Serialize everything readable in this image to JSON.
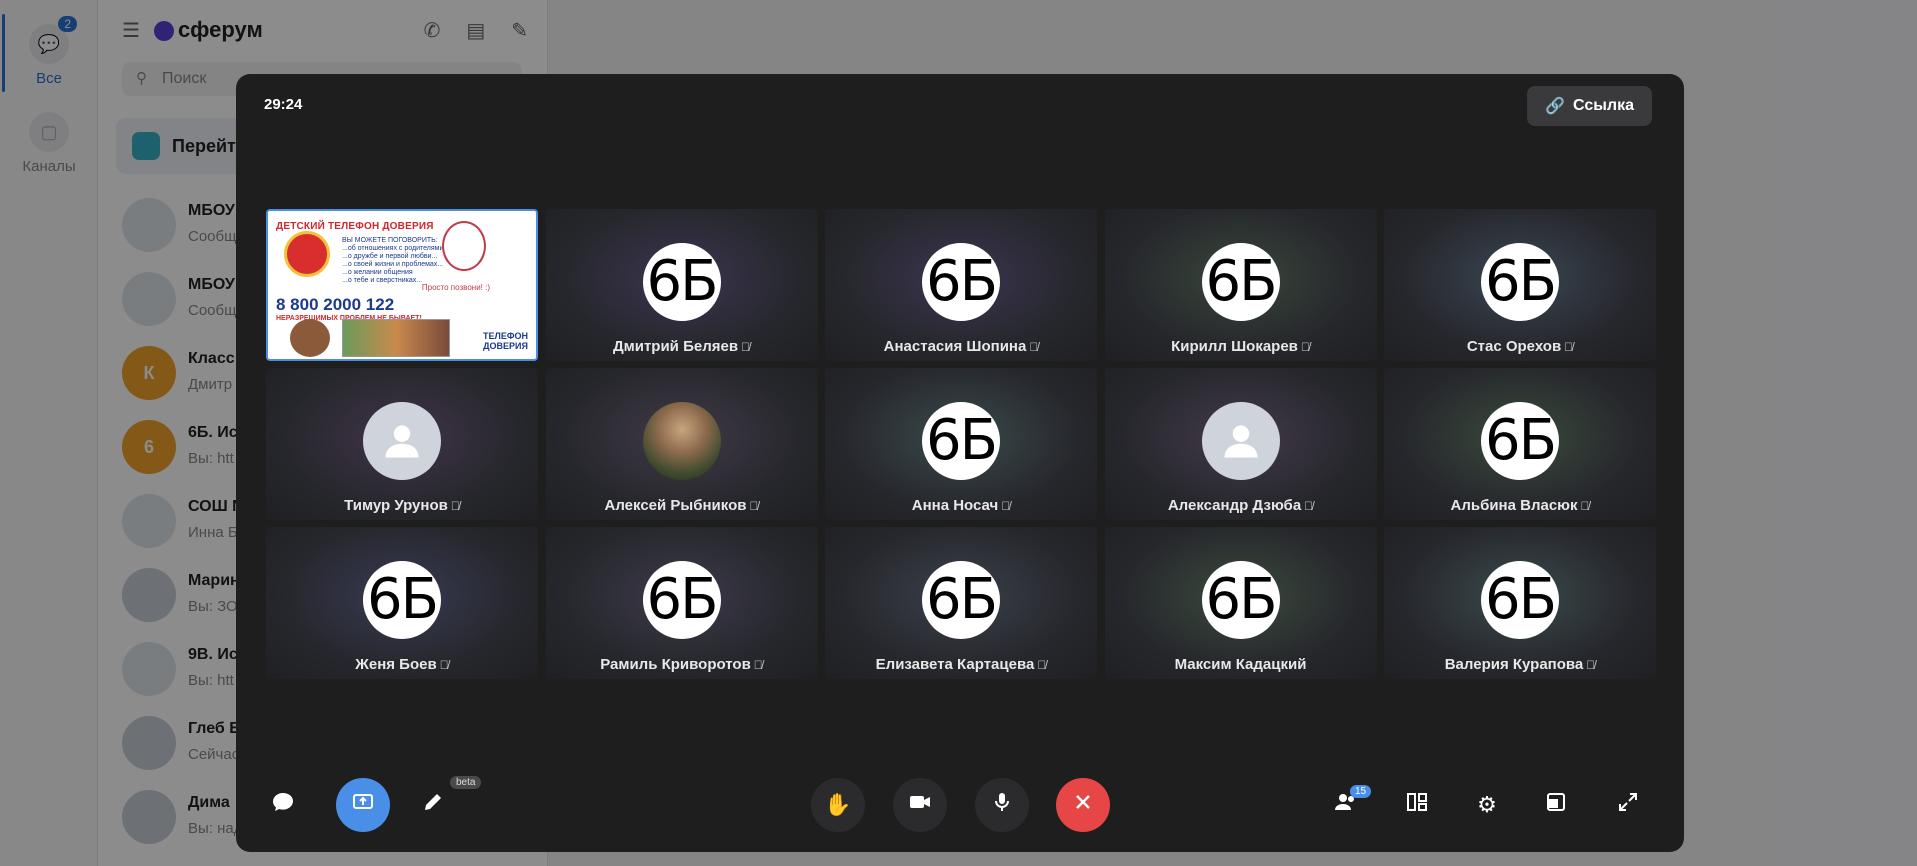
{
  "sidebar": {
    "all_label": "Все",
    "all_badge": "2",
    "channels_label": "Каналы"
  },
  "list": {
    "brand": "сферум",
    "search_placeholder": "Поиск",
    "goto_label": "Перейт",
    "chats": [
      {
        "title": "МБОУ",
        "snippet": "Сообщ",
        "avatar": ""
      },
      {
        "title": "МБОУ",
        "snippet": "Сообщ",
        "avatar": ""
      },
      {
        "title": "Класс",
        "snippet": "Дмитр",
        "avatar": "К"
      },
      {
        "title": "6Б. Ис",
        "snippet": "Вы: htt",
        "avatar": "6"
      },
      {
        "title": "СОШ N",
        "snippet": "Инна Б",
        "avatar": ""
      },
      {
        "title": "Марин",
        "snippet": "Вы: ЗО",
        "avatar": ""
      },
      {
        "title": "9В. Ис",
        "snippet": "Вы: htt",
        "avatar": ""
      },
      {
        "title": "Глеб Б",
        "snippet": "Сейчас",
        "avatar": ""
      },
      {
        "title": "Дима",
        "snippet": "Вы: над",
        "avatar": ""
      }
    ]
  },
  "call": {
    "timer": "29:24",
    "link_label": "Ссылка",
    "share_poster": {
      "title": "ДЕТСКИЙ ТЕЛЕФОН ДОВЕРИЯ",
      "lines": [
        "ВЫ МОЖЕТЕ ПОГОВОРИТЬ:",
        "...об отношениях с родителями",
        "...о дружбе и первой любви...",
        "...о своей жизни и проблемах...",
        "...о желании общения",
        "...о тебе и сверстниках..."
      ],
      "phone": "8 800 2000 122",
      "subtitle": "НЕРАЗРЕШИМЫХ ПРОБЛЕМ НЕ БЫВАЕТ!",
      "caption": "Просто позвони! :)",
      "logo": "ТЕЛЕФОН\nДОВЕРИЯ"
    },
    "participants": [
      {
        "name": "Дмитрий Беляев",
        "avatar": "6Б",
        "muted": true,
        "glow": "#3a3550"
      },
      {
        "name": "Анастасия Шопина",
        "avatar": "6Б",
        "muted": true,
        "glow": "#3a3550"
      },
      {
        "name": "Кирилл Шокарев",
        "avatar": "6Б",
        "muted": true,
        "glow": "#38463a"
      },
      {
        "name": "Стас Орехов",
        "avatar": "6Б",
        "muted": true,
        "glow": "#3a4652"
      },
      {
        "name": "Тимур Урунов",
        "avatar": "",
        "muted": true,
        "glow": "#403448"
      },
      {
        "name": "Алексей Рыбников",
        "avatar": "photo",
        "muted": true,
        "glow": "#403a48"
      },
      {
        "name": "Анна Носач",
        "avatar": "6Б",
        "muted": true,
        "glow": "#3a4a4a"
      },
      {
        "name": "Александр Дзюба",
        "avatar": "",
        "muted": true,
        "glow": "#433a4a"
      },
      {
        "name": "Альбина Власюк",
        "avatar": "6Б",
        "muted": true,
        "glow": "#3a4a3c"
      },
      {
        "name": "Женя Боев",
        "avatar": "6Б",
        "muted": true,
        "glow": "#383a52"
      },
      {
        "name": "Рамиль Криворотов",
        "avatar": "6Б",
        "muted": true,
        "glow": "#3c3a4a"
      },
      {
        "name": "Елизавета Картацева",
        "avatar": "6Б",
        "muted": true,
        "glow": "#3a404a"
      },
      {
        "name": "Максим Кадацкий",
        "avatar": "6Б",
        "muted": false,
        "glow": "#3a4a3c"
      },
      {
        "name": "Валерия Курапова",
        "avatar": "6Б",
        "muted": true,
        "glow": "#3a4a4a"
      }
    ],
    "toolbar": {
      "beta_label": "beta",
      "participants_count": "15"
    }
  },
  "colors": {
    "accent": "#4a8fe7",
    "end_call": "#e64646",
    "modal_bg": "#1e1e1e"
  }
}
